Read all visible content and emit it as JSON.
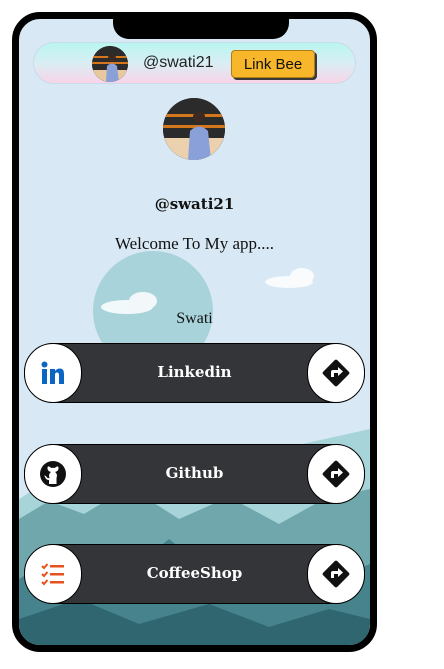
{
  "colors": {
    "screen_bg": "#d8e8f4",
    "link_bg": "#333538",
    "button_yellow": "#f8b62a",
    "linkedin_blue": "#0a66c2",
    "coffeeshop_orange": "#e8501e"
  },
  "topbar": {
    "handle": "@swati21",
    "button_label": "Link Bee"
  },
  "profile": {
    "handle": "@swati21",
    "welcome": "Welcome To My app....",
    "name": "Swati"
  },
  "links": [
    {
      "label": "Linkedin",
      "icon": "linkedin-icon",
      "action_icon": "directions-icon"
    },
    {
      "label": "Github",
      "icon": "github-icon",
      "action_icon": "directions-icon"
    },
    {
      "label": "CoffeeShop",
      "icon": "checklist-icon",
      "action_icon": "directions-icon"
    }
  ]
}
